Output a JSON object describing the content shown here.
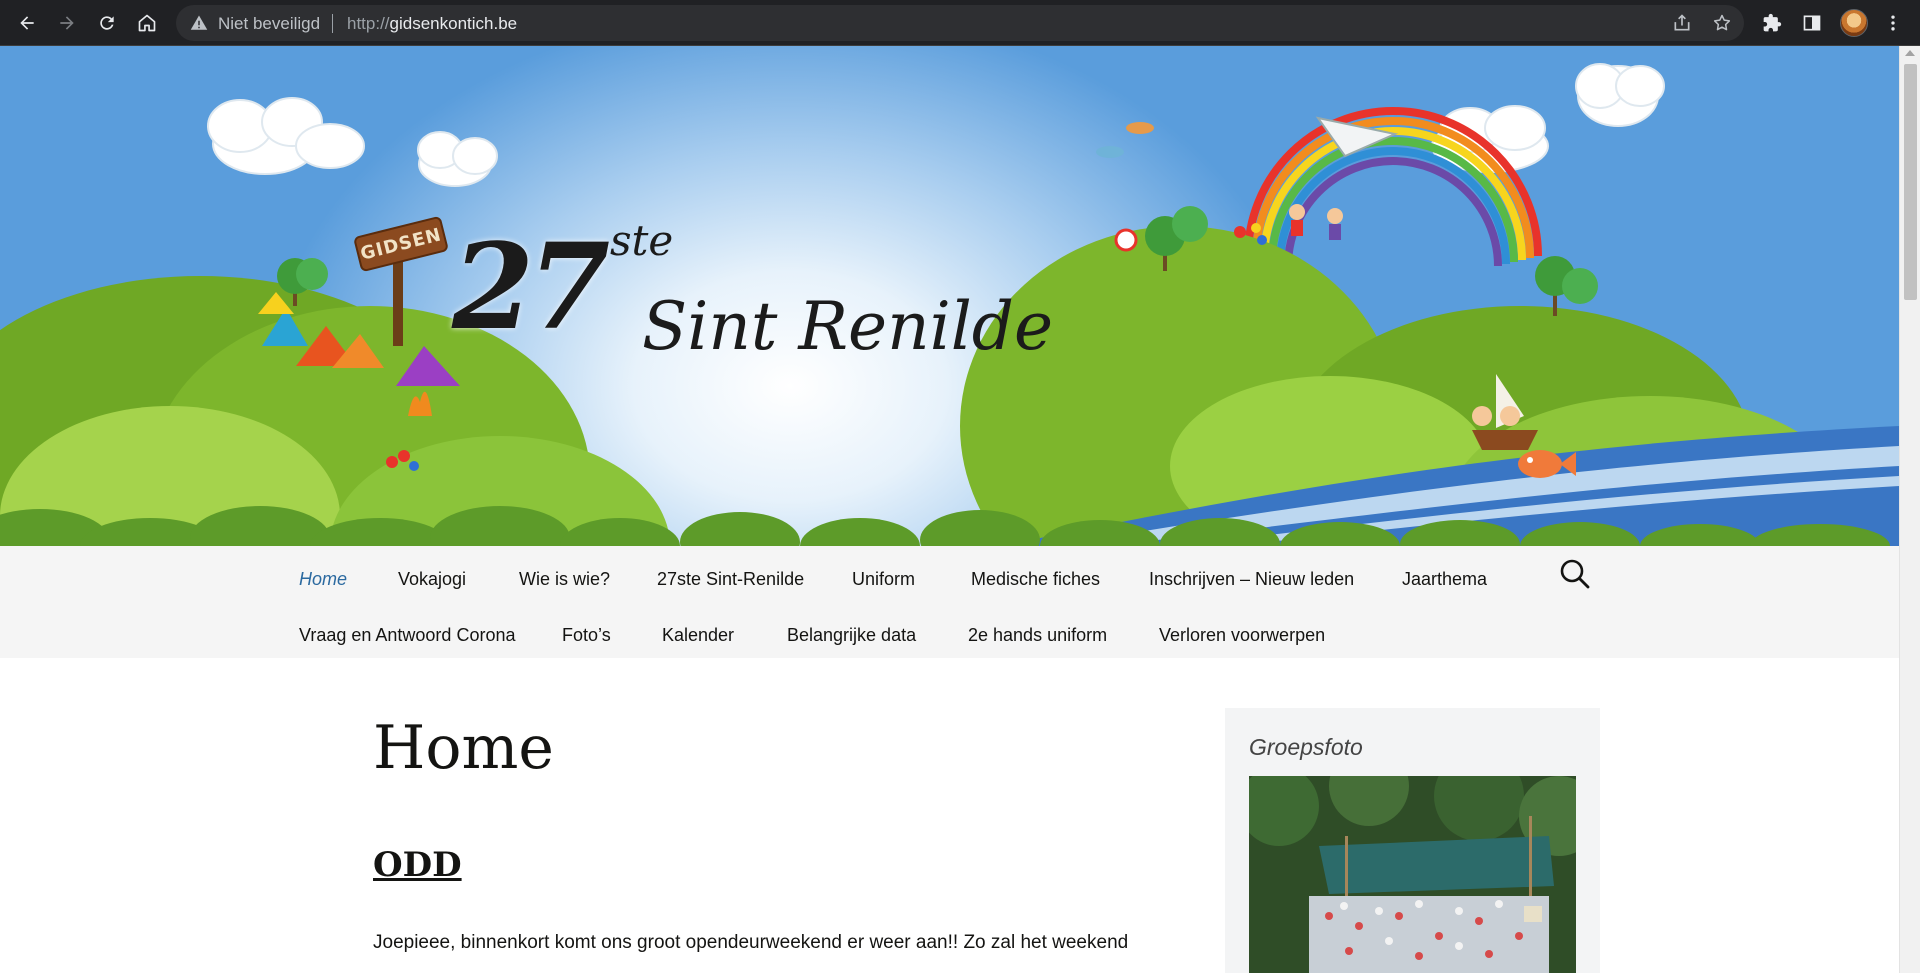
{
  "browser": {
    "security_label": "Niet beveiligd",
    "url_prefix": "http://",
    "url_host": "gidsenkontich.be"
  },
  "banner": {
    "logo_number": "27",
    "logo_suffix": "ste",
    "logo_name": "Sint Renilde",
    "sign_text": "GIDSEN"
  },
  "nav": {
    "items": [
      {
        "label": "Home",
        "active": true
      },
      {
        "label": "Vokajogi"
      },
      {
        "label": "Wie is wie?"
      },
      {
        "label": "27ste Sint-Renilde"
      },
      {
        "label": "Uniform"
      },
      {
        "label": "Medische fiches"
      },
      {
        "label": "Inschrijven – Nieuw leden"
      },
      {
        "label": "Jaarthema"
      },
      {
        "label": "Vraag en Antwoord Corona"
      },
      {
        "label": "Foto’s"
      },
      {
        "label": "Kalender"
      },
      {
        "label": "Belangrijke data"
      },
      {
        "label": "2e hands uniform"
      },
      {
        "label": "Verloren voorwerpen"
      }
    ],
    "search_icon": "search-icon"
  },
  "main": {
    "page_title": "Home",
    "post_title": "ODD",
    "post_excerpt": "Joepieee, binnenkort komt ons groot opendeurweekend er weer aan!! Zo zal het weekend"
  },
  "sidebar": {
    "widget_title": "Groepsfoto"
  },
  "colors": {
    "chrome_bg": "#202124",
    "nav_bg": "#f5f5f5",
    "active_link": "#2c6aa0",
    "sidebar_bg": "#f3f4f5"
  }
}
